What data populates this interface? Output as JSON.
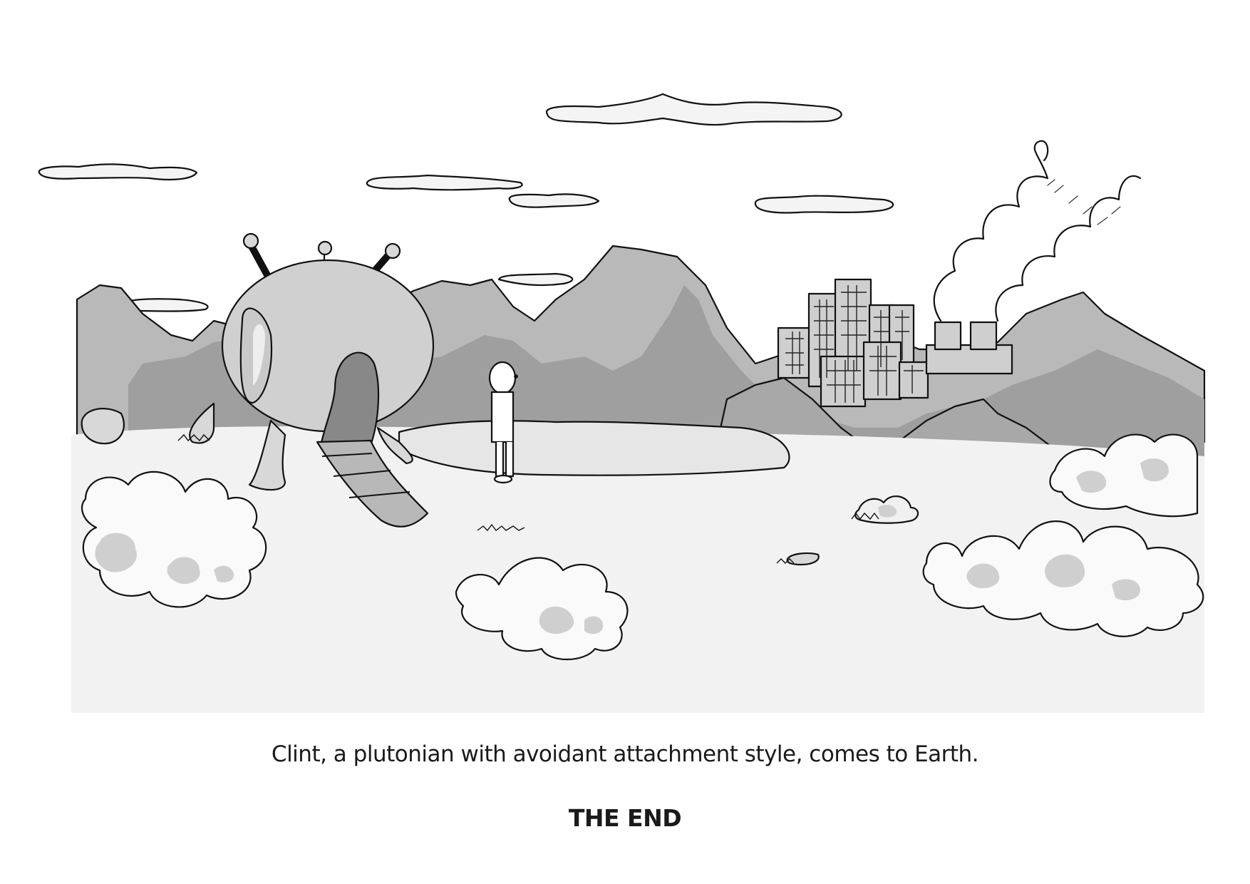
{
  "caption": {
    "line": "Clint, a plutonian with avoidant attachment style, comes to Earth.",
    "end": "THE END"
  },
  "scene": {
    "icons": [
      "cloud-icon",
      "mountain-icon",
      "spaceship-icon",
      "character-icon",
      "city-icon",
      "smoke-icon",
      "bush-icon",
      "rock-icon"
    ]
  }
}
